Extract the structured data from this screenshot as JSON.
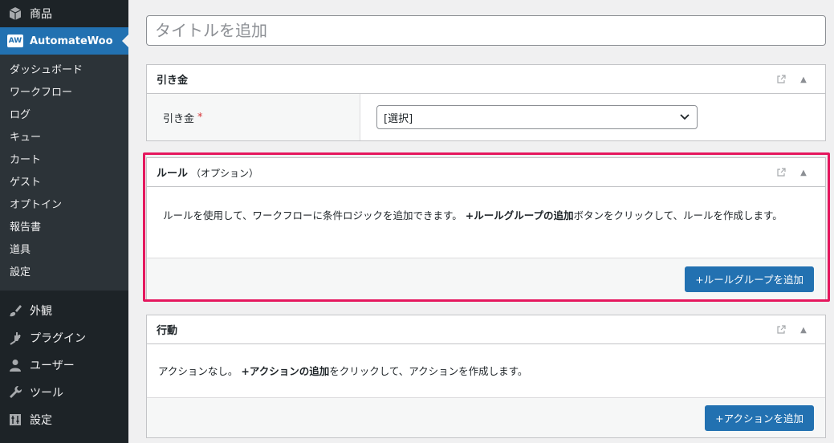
{
  "sidebar": {
    "top_items": [
      {
        "label": "商品",
        "icon": "box-icon"
      },
      {
        "label": "AutomateWoo",
        "badge": "AW"
      }
    ],
    "submenu": [
      "ダッシュボード",
      "ワークフロー",
      "ログ",
      "キュー",
      "カート",
      "ゲスト",
      "オプトイン",
      "報告書",
      "道具",
      "設定"
    ],
    "lower_items": [
      {
        "label": "外観",
        "icon": "brush-icon"
      },
      {
        "label": "プラグイン",
        "icon": "plug-icon"
      },
      {
        "label": "ユーザー",
        "icon": "user-icon"
      },
      {
        "label": "ツール",
        "icon": "wrench-icon"
      },
      {
        "label": "設定",
        "icon": "settings-icon"
      }
    ]
  },
  "title": {
    "placeholder": "タイトルを追加"
  },
  "trigger_box": {
    "title": "引き金",
    "field_label": "引き金",
    "required_mark": "*",
    "select_value": "[選択]"
  },
  "rules_box": {
    "title": "ルール",
    "subtitle": "（オプション）",
    "text_before": "ルールを使用して、ワークフローに条件ロジックを追加できます。 ",
    "text_bold": "+ルールグループの追加",
    "text_after": "ボタンをクリックして、ルールを作成します。",
    "button": "+ルールグループを追加"
  },
  "actions_box": {
    "title": "行動",
    "text_before": "アクションなし。 ",
    "text_bold": "+アクションの追加",
    "text_after": "をクリックして、アクションを作成します。",
    "button": "+アクションを追加"
  },
  "colors": {
    "accent": "#2271b1",
    "highlight": "#e5175e",
    "sidebar": "#1d2327"
  }
}
